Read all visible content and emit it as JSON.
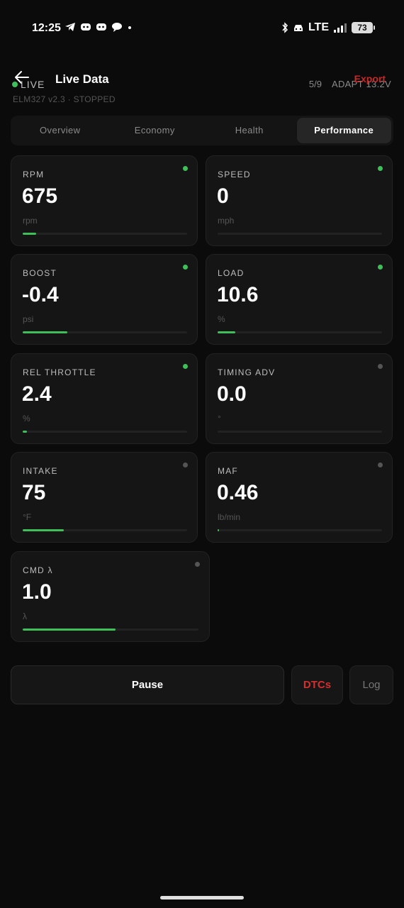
{
  "status_bar": {
    "time": "12:25",
    "network": "LTE",
    "battery": "73"
  },
  "header": {
    "live_label": "LIVE",
    "title": "Live Data",
    "subtitle": "ELM327 v2.3 · STOPPED",
    "pid_count": "5/9",
    "adapter_voltage": "ADAPT 13.2V",
    "export_label": "Export"
  },
  "tabs": [
    {
      "label": "Overview",
      "active": false
    },
    {
      "label": "Economy",
      "active": false
    },
    {
      "label": "Health",
      "active": false
    },
    {
      "label": "Performance",
      "active": true
    }
  ],
  "metrics": [
    {
      "label": "RPM",
      "value": "675",
      "unit": "rpm",
      "active": true,
      "level": 0.08
    },
    {
      "label": "SPEED",
      "value": "0",
      "unit": "mph",
      "active": true,
      "level": 0
    },
    {
      "label": "BOOST",
      "value": "-0.4",
      "unit": "psi",
      "active": true,
      "level": 0.27
    },
    {
      "label": "LOAD",
      "value": "10.6",
      "unit": "%",
      "active": true,
      "level": 0.106
    },
    {
      "label": "REL THROTTLE",
      "value": "2.4",
      "unit": "%",
      "active": true,
      "level": 0.024
    },
    {
      "label": "TIMING ADV",
      "value": "0.0",
      "unit": "°",
      "active": false,
      "level": 0
    },
    {
      "label": "INTAKE",
      "value": "75",
      "unit": "°F",
      "active": false,
      "level": 0.25
    },
    {
      "label": "MAF",
      "value": "0.46",
      "unit": "lb/min",
      "active": false,
      "level": 0.01
    },
    {
      "label": "CMD λ",
      "value": "1.0",
      "unit": "λ",
      "active": false,
      "level": 0.53
    }
  ],
  "actions": {
    "pause_label": "Pause",
    "dtcs_label": "DTCs",
    "log_label": "Log"
  },
  "colors": {
    "accent": "#3fbf5a",
    "danger": "#d32f2f",
    "background": "#0b0b0b",
    "card": "#151515"
  }
}
